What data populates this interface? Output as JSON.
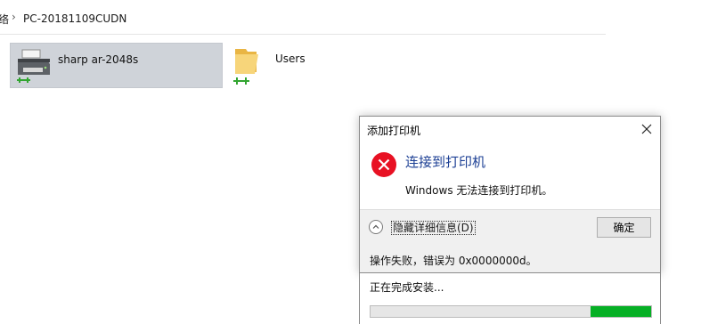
{
  "address_bar": {
    "prev_segment": "络",
    "current_segment": "PC-20181109CUDN"
  },
  "items": [
    {
      "label": "sharp ar-2048s",
      "icon": "printer-icon",
      "selected": true
    },
    {
      "label": "Users",
      "icon": "shared-folder-icon",
      "selected": false
    }
  ],
  "dialog": {
    "title": "添加打印机",
    "heading": "连接到打印机",
    "message": "Windows 无法连接到打印机。",
    "details_toggle_label": "隐藏详细信息(D)",
    "ok_label": "确定",
    "error_detail": "操作失败，错误为 0x0000000d。"
  },
  "progress": {
    "status_text": "正在完成安装...",
    "fill_start": 0.785,
    "fill_end": 1.0
  },
  "colors": {
    "heading": "#1c3f94",
    "error_red": "#e81123",
    "progress_green": "#06b025",
    "selection_bg": "#cfd3d9",
    "button_bar_bg": "#f0f0f0"
  }
}
